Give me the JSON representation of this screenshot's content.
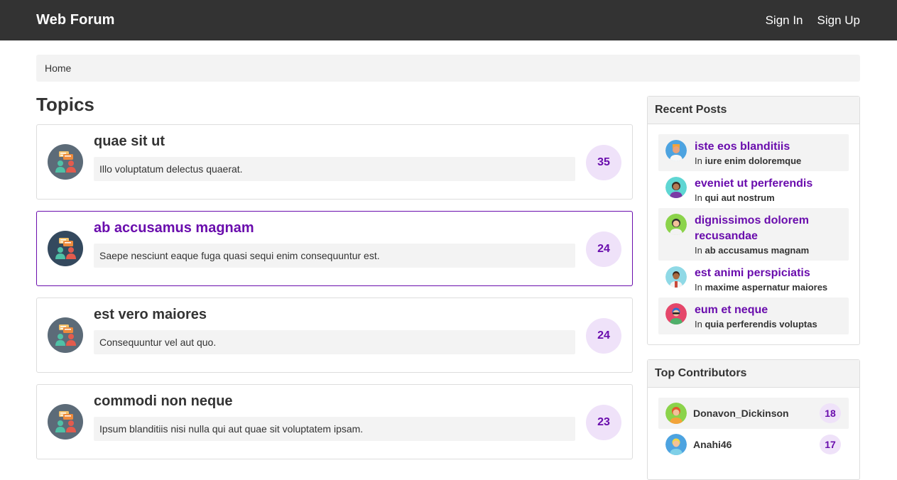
{
  "navbar": {
    "brand": "Web Forum",
    "sign_in": "Sign In",
    "sign_up": "Sign Up"
  },
  "breadcrumb": {
    "home": "Home"
  },
  "topics": {
    "heading": "Topics",
    "items": [
      {
        "title": "quae sit ut",
        "description": "Illo voluptatum delectus quaerat.",
        "count": "35"
      },
      {
        "title": "ab accusamus magnam",
        "description": "Saepe nesciunt eaque fuga quasi sequi enim consequuntur est.",
        "count": "24"
      },
      {
        "title": "est vero maiores",
        "description": "Consequuntur vel aut quo.",
        "count": "24"
      },
      {
        "title": "commodi non neque",
        "description": "Ipsum blanditiis nisi nulla qui aut quae sit voluptatem ipsam.",
        "count": "23"
      }
    ]
  },
  "recent_posts": {
    "heading": "Recent Posts",
    "in_label": "In",
    "items": [
      {
        "title": "iste eos blanditiis",
        "topic": "iure enim doloremque"
      },
      {
        "title": "eveniet ut perferendis",
        "topic": "qui aut nostrum"
      },
      {
        "title": "dignissimos dolorem recusandae",
        "topic": "ab accusamus magnam"
      },
      {
        "title": "est animi perspiciatis",
        "topic": "maxime aspernatur maiores"
      },
      {
        "title": "eum et neque",
        "topic": "quia perferendis voluptas"
      }
    ]
  },
  "top_contributors": {
    "heading": "Top Contributors",
    "items": [
      {
        "name": "Donavon_Dickinson",
        "count": "18"
      },
      {
        "name": "Anahi46",
        "count": "17"
      }
    ]
  },
  "colors": {
    "accent": "#6a0dad",
    "navbar": "#333333",
    "count_bg": "#efe2f9"
  }
}
